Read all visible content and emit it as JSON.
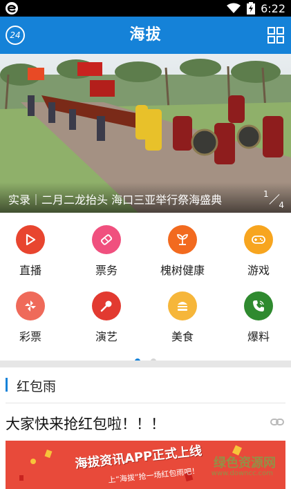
{
  "status_bar": {
    "time": "6:22"
  },
  "app_bar": {
    "title": "海拔",
    "logo_text": "24"
  },
  "banner": {
    "caption": "实录｜二月二龙抬头 海口三亚举行祭海盛典",
    "current_page": "1",
    "total_pages": "4"
  },
  "menu": {
    "items": [
      {
        "label": "直播",
        "icon": "play-icon",
        "color": "#e8452f"
      },
      {
        "label": "票务",
        "icon": "ticket-icon",
        "color": "#f0507e"
      },
      {
        "label": "槐树健康",
        "icon": "leaf-icon",
        "color": "#f26a1f"
      },
      {
        "label": "游戏",
        "icon": "gamepad-icon",
        "color": "#f7a51f"
      },
      {
        "label": "彩票",
        "icon": "pinwheel-icon",
        "color": "#ef6a5a"
      },
      {
        "label": "演艺",
        "icon": "microphone-icon",
        "color": "#e23a30"
      },
      {
        "label": "美食",
        "icon": "burger-icon",
        "color": "#f6b63a"
      },
      {
        "label": "爆料",
        "icon": "phone-icon",
        "color": "#2f8a2f"
      }
    ],
    "page_dots": 2,
    "active_dot": 0
  },
  "section": {
    "title": "红包雨"
  },
  "article": {
    "title": "大家快来抢红包啦！！！"
  },
  "ad": {
    "headline": "海拔资讯APP正式上线",
    "subline": "上“海拔”抢一场红包雨吧！",
    "watermark": "绿色资源网",
    "watermark_url": "www.downcc.com"
  },
  "colors": {
    "primary": "#1582d8"
  }
}
